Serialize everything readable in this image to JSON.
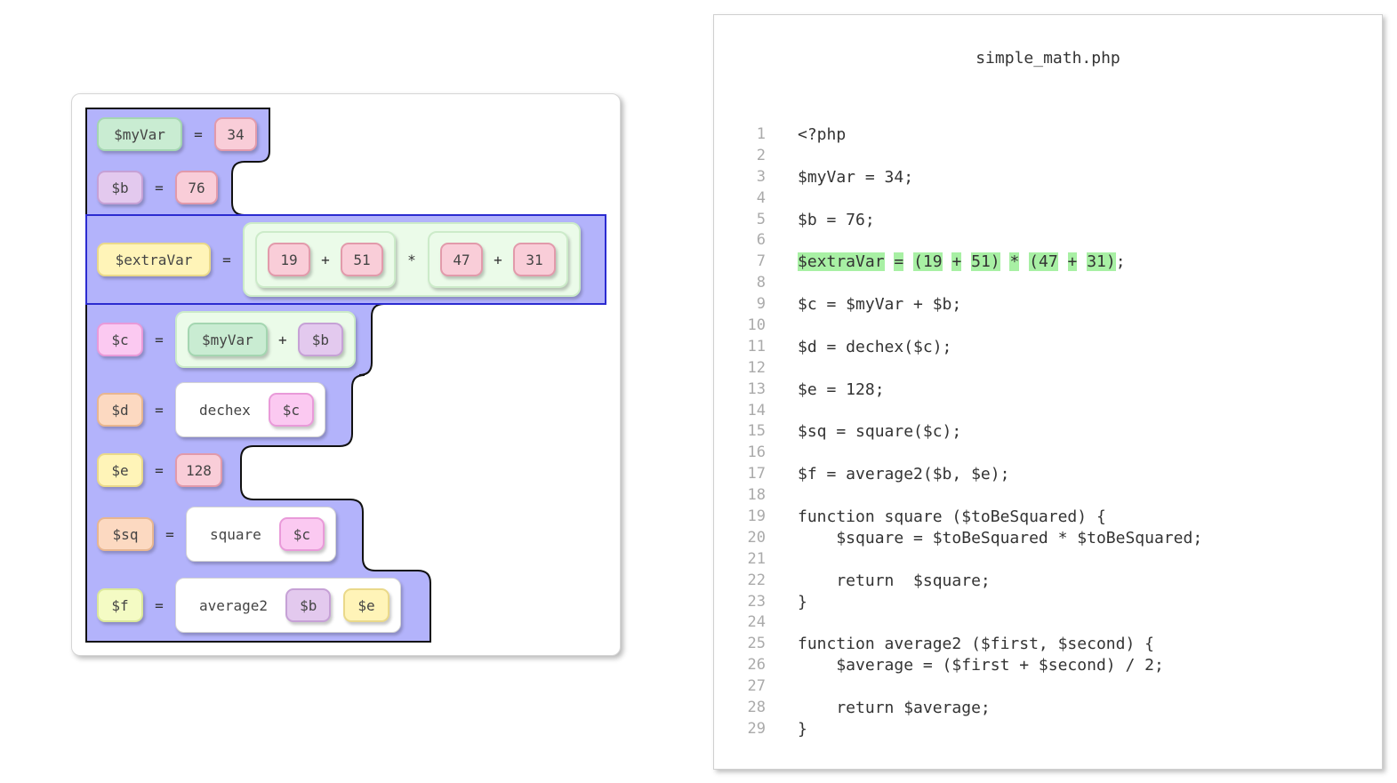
{
  "blocks": {
    "rows": [
      {
        "var": "$myVar",
        "var_color": "green",
        "op": "=",
        "value": "34"
      },
      {
        "var": "$b",
        "var_color": "purple",
        "op": "=",
        "value": "76"
      },
      {
        "var": "$extraVar",
        "var_color": "yellow",
        "op": "=",
        "expr": {
          "left": {
            "a": "19",
            "op": "+",
            "b": "51"
          },
          "op": "*",
          "right": {
            "a": "47",
            "op": "+",
            "b": "31"
          }
        }
      },
      {
        "var": "$c",
        "var_color": "magenta",
        "op": "=",
        "expr": {
          "a": "$myVar",
          "op": "+",
          "b": "$b"
        }
      },
      {
        "var": "$d",
        "var_color": "orange",
        "op": "=",
        "call": {
          "name": "dechex",
          "args": [
            "$c"
          ]
        }
      },
      {
        "var": "$e",
        "var_color": "yellow",
        "op": "=",
        "value": "128"
      },
      {
        "var": "$sq",
        "var_color": "orange",
        "op": "=",
        "call": {
          "name": "square",
          "args": [
            "$c"
          ]
        }
      },
      {
        "var": "$f",
        "var_color": "green",
        "op": "=",
        "call": {
          "name": "average2",
          "args": [
            "$b",
            "$e"
          ]
        }
      }
    ]
  },
  "code": {
    "filename": "simple_math.php",
    "highlighted_line": 7,
    "lines": [
      "<?php",
      "",
      "$myVar = 34;",
      "",
      "$b = 76;",
      "",
      "$extraVar = (19 + 51) * (47 + 31);",
      "",
      "$c = $myVar + $b;",
      "",
      "$d = dechex($c);",
      "",
      "$e = 128;",
      "",
      "$sq = square($c);",
      "",
      "$f = average2($b, $e);",
      "",
      "function square ($toBeSquared) {",
      "    $square = $toBeSquared * $toBeSquared;",
      "",
      "    return  $square;",
      "}",
      "",
      "function average2 ($first, $second) {",
      "    $average = ($first + $second) / 2;",
      "",
      "    return $average;",
      "}"
    ],
    "highlight_parts": [
      "$extraVar",
      "=",
      "(19",
      "+",
      "51)",
      "*",
      "(47",
      "+",
      "31)"
    ],
    "highlight_trailing": ";"
  },
  "colors": {
    "stack_fill": "#b3b3fb",
    "stack_outline": "#111111",
    "selected_outline": "#2b2bd0",
    "highlight": "#a8f0a4"
  }
}
